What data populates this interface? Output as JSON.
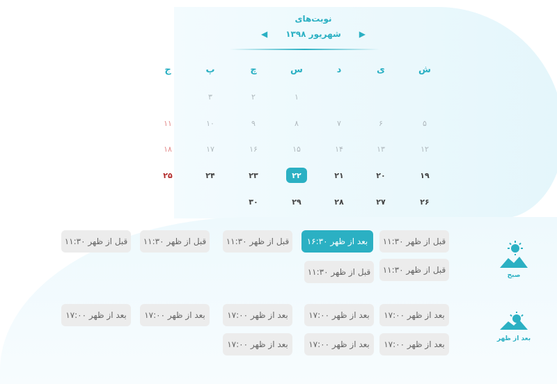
{
  "header": {
    "title": "نوبت‌های",
    "month": "شهریور ۱۳۹۸"
  },
  "weekdays": [
    "ش",
    "ی",
    "د",
    "س",
    "چ",
    "پ",
    "ج"
  ],
  "weeks": [
    [
      "",
      "",
      "",
      "۱",
      "۲",
      "۳",
      ""
    ],
    [
      "۵",
      "۶",
      "۷",
      "۸",
      "۹",
      "۱۰",
      "۱۱"
    ],
    [
      "۱۲",
      "۱۳",
      "۱۴",
      "۱۵",
      "۱۶",
      "۱۷",
      "۱۸"
    ],
    [
      "۱۹",
      "۲۰",
      "۲۱",
      "۲۲",
      "۲۳",
      "۲۴",
      "۲۵"
    ],
    [
      "۲۶",
      "۲۷",
      "۲۸",
      "۲۹",
      "۳۰",
      "",
      ""
    ]
  ],
  "selected_day": "۲۲",
  "periods": {
    "morning": {
      "label": "صبح",
      "slots": [
        "۱۱:۳۰ قبل از ظهر",
        "۱۶:۳۰ بعد از ظهر",
        "۱۱:۳۰ قبل از ظهر",
        "۱۱:۳۰ قبل از ظهر",
        "۱۱:۳۰ قبل از ظهر",
        "۱۱:۳۰ قبل از ظهر",
        "۱۱:۳۰ قبل از ظهر"
      ],
      "active_index": 1
    },
    "afternoon": {
      "label": "بعد از ظهر",
      "slots": [
        "۱۷:۰۰ بعد از ظهر",
        "۱۷:۰۰ بعد از ظهر",
        "۱۷:۰۰ بعد از ظهر",
        "۱۷:۰۰ بعد از ظهر",
        "۱۷:۰۰ بعد از ظهر",
        "۱۷:۰۰ بعد از ظهر",
        "۱۷:۰۰ بعد از ظهر",
        "۱۷:۰۰ بعد از ظهر"
      ]
    }
  },
  "colors": {
    "accent": "#2bb0c3",
    "friday": "#b22a2a",
    "slot_bg": "#ececec"
  }
}
